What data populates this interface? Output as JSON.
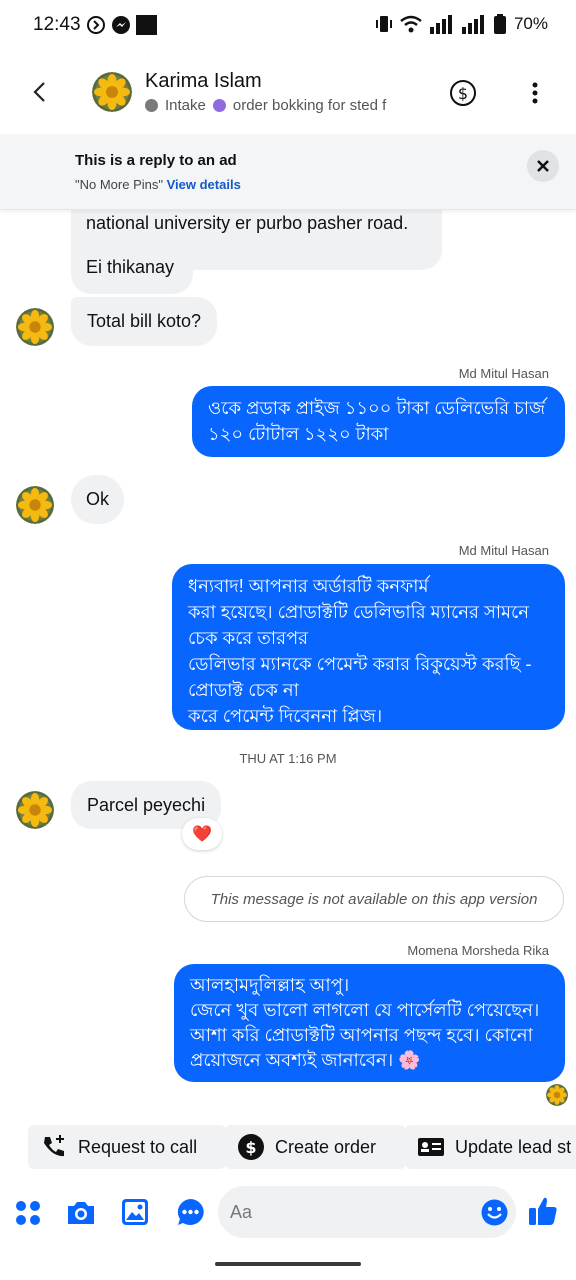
{
  "status_bar": {
    "time": "12:43",
    "battery": "70%"
  },
  "header": {
    "name": "Karima Islam",
    "tag1": "Intake",
    "tag2": "order bokking for sted f",
    "colors": {
      "tag1_dot": "#7a7a7a",
      "tag2_dot": "#8f6ae0"
    }
  },
  "ad_banner": {
    "title": "This is a reply to an ad",
    "subtitle": "\"No More Pins\"",
    "link": "View details"
  },
  "messages": {
    "m1_line1": "national university er purbo pasher road.",
    "m1_line2": "Ei thikanay",
    "m2": "Total bill koto?",
    "m3_sender": "Md Mitul Hasan",
    "m3_line1": "ওকে প্রডাক প্রাইজ ১১০০ টাকা ডেলিভেরি চার্জ",
    "m3_line2": "১২০ টোটাল ১২২০ টাকা",
    "m4": "Ok",
    "m5_sender": "Md Mitul Hasan",
    "m5_line1": "ধন্যবাদ! আপনার অর্ডারটি কনফার্ম",
    "m5_line2": "করা হয়েছে। প্রোডাক্টটি ডেলিভারি ম্যানের সামনে",
    "m5_line3": "চেক করে তারপর",
    "m5_line4": "ডেলিভার ম্যানকে পেমেন্ট করার রিকুয়েস্ট করছি -",
    "m5_line5": "প্রোডাক্ট চেক না",
    "m5_line6": "করে পেমেন্ট দিবেননা প্লিজ।",
    "time_divider": "THU AT 1:16 PM",
    "m6": "Parcel peyechi",
    "m6_reaction": "❤️",
    "m7": "This message is not available on this app version",
    "m8_sender": "Momena Morsheda Rika",
    "m8_line1": "আলহামদুলিল্লাহ আপু।",
    "m8_line2": "জেনে খুব ভালো লাগলো যে পার্সেলটি পেয়েছেন।",
    "m8_line3": "আশা করি প্রোডাক্টটি আপনার পছন্দ হবে। কোনো",
    "m8_line4": "প্রয়োজনে অবশ্যই জানাবেন। 🌸"
  },
  "quick_actions": {
    "request_call": "Request to call",
    "create_order": "Create order",
    "update_lead": "Update lead st"
  },
  "composer": {
    "placeholder": "Aa"
  },
  "colors": {
    "accent": "#0866ff",
    "incoming_bubble": "#f0f1f3"
  }
}
